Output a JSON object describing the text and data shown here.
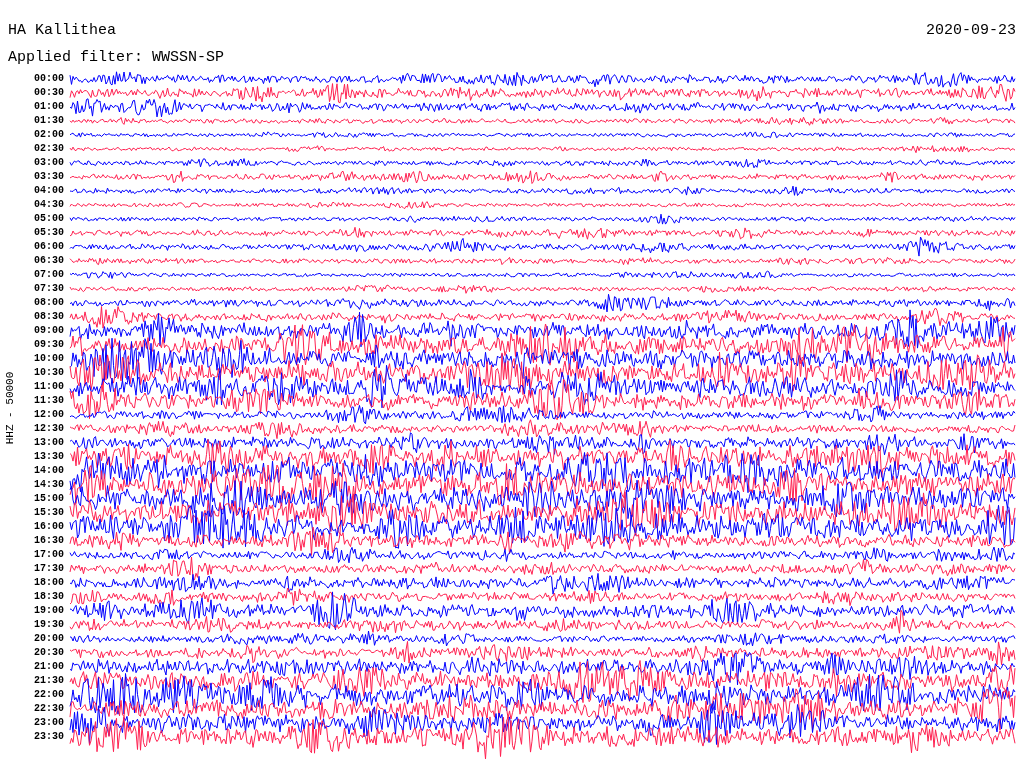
{
  "header": {
    "station": "HA Kallithea",
    "date": "2020-09-23",
    "filter": "Applied filter: WWSSN-SP"
  },
  "axis_label": "HHZ - 50000",
  "rows": [
    {
      "time": "00:00",
      "color": "#0000ff"
    },
    {
      "time": "00:30",
      "color": "#ff2050"
    },
    {
      "time": "01:00",
      "color": "#0000ff"
    },
    {
      "time": "01:30",
      "color": "#ff2050"
    },
    {
      "time": "02:00",
      "color": "#0000ff"
    },
    {
      "time": "02:30",
      "color": "#ff2050"
    },
    {
      "time": "03:00",
      "color": "#0000ff"
    },
    {
      "time": "03:30",
      "color": "#ff2050"
    },
    {
      "time": "04:00",
      "color": "#0000ff"
    },
    {
      "time": "04:30",
      "color": "#ff2050"
    },
    {
      "time": "05:00",
      "color": "#0000ff"
    },
    {
      "time": "05:30",
      "color": "#ff2050"
    },
    {
      "time": "06:00",
      "color": "#0000ff"
    },
    {
      "time": "06:30",
      "color": "#ff2050"
    },
    {
      "time": "07:00",
      "color": "#0000ff"
    },
    {
      "time": "07:30",
      "color": "#ff2050"
    },
    {
      "time": "08:00",
      "color": "#0000ff"
    },
    {
      "time": "08:30",
      "color": "#ff2050"
    },
    {
      "time": "09:00",
      "color": "#0000ff"
    },
    {
      "time": "09:30",
      "color": "#ff2050"
    },
    {
      "time": "10:00",
      "color": "#0000ff"
    },
    {
      "time": "10:30",
      "color": "#ff2050"
    },
    {
      "time": "11:00",
      "color": "#0000ff"
    },
    {
      "time": "11:30",
      "color": "#ff2050"
    },
    {
      "time": "12:00",
      "color": "#0000ff"
    },
    {
      "time": "12:30",
      "color": "#ff2050"
    },
    {
      "time": "13:00",
      "color": "#0000ff"
    },
    {
      "time": "13:30",
      "color": "#ff2050"
    },
    {
      "time": "14:00",
      "color": "#0000ff"
    },
    {
      "time": "14:30",
      "color": "#ff2050"
    },
    {
      "time": "15:00",
      "color": "#0000ff"
    },
    {
      "time": "15:30",
      "color": "#ff2050"
    },
    {
      "time": "16:00",
      "color": "#0000ff"
    },
    {
      "time": "16:30",
      "color": "#ff2050"
    },
    {
      "time": "17:00",
      "color": "#0000ff"
    },
    {
      "time": "17:30",
      "color": "#ff2050"
    },
    {
      "time": "18:00",
      "color": "#0000ff"
    },
    {
      "time": "18:30",
      "color": "#ff2050"
    },
    {
      "time": "19:00",
      "color": "#0000ff"
    },
    {
      "time": "19:30",
      "color": "#ff2050"
    },
    {
      "time": "20:00",
      "color": "#0000ff"
    },
    {
      "time": "20:30",
      "color": "#ff2050"
    },
    {
      "time": "21:00",
      "color": "#0000ff"
    },
    {
      "time": "21:30",
      "color": "#ff2050"
    },
    {
      "time": "22:00",
      "color": "#0000ff"
    },
    {
      "time": "22:30",
      "color": "#ff2050"
    },
    {
      "time": "23:00",
      "color": "#0000ff"
    },
    {
      "time": "23:30",
      "color": "#ff2050"
    }
  ]
}
